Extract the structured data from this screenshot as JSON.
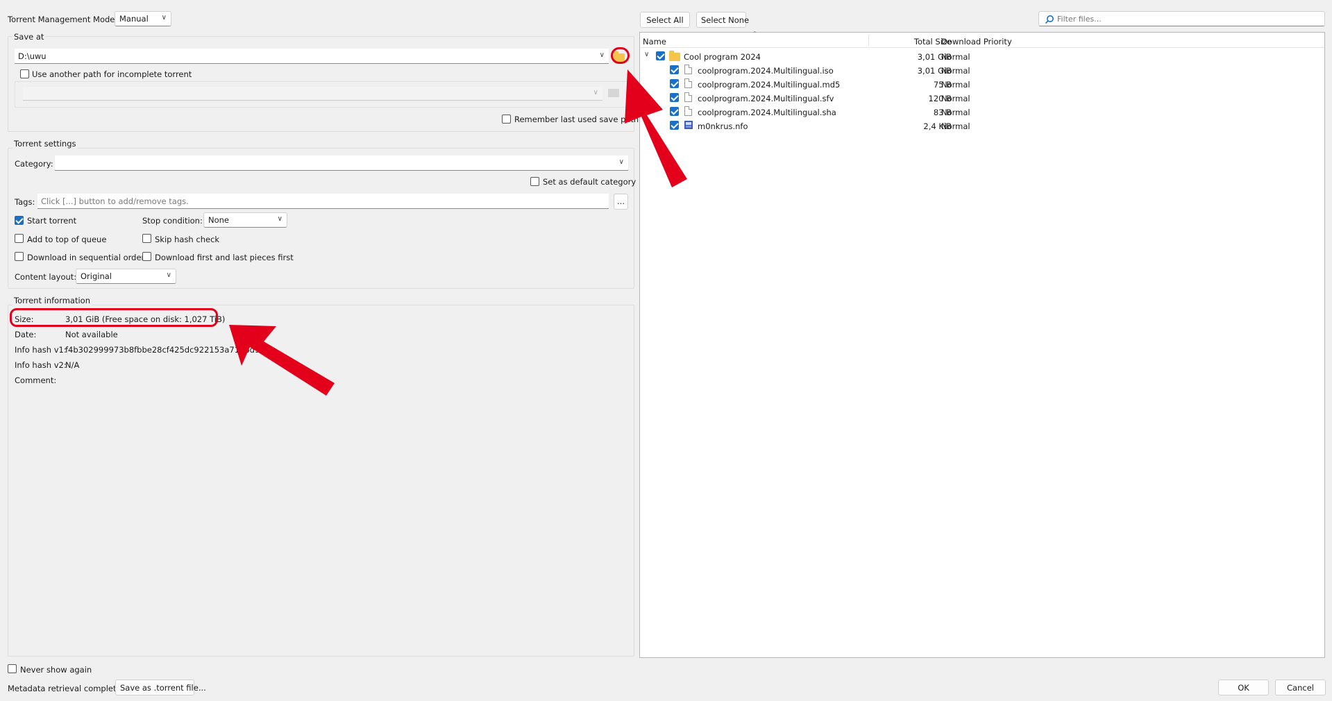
{
  "top": {
    "mode_label": "Torrent Management Mode:",
    "mode_value": "Manual",
    "select_all": "Select All",
    "select_none": "Select None",
    "filter_placeholder": "Filter files..."
  },
  "save_at": {
    "group_label": "Save at",
    "path": "D:\\uwu",
    "use_another_path": "Use another path for incomplete torrent",
    "remember": "Remember last used save path"
  },
  "settings": {
    "group_label": "Torrent settings",
    "category_label": "Category:",
    "default_category": "Set as default category",
    "tags_label": "Tags:",
    "tags_placeholder": "Click [...] button to add/remove tags.",
    "tags_button": "...",
    "start_torrent": "Start torrent",
    "stop_condition_label": "Stop condition:",
    "stop_condition_value": "None",
    "add_top": "Add to top of queue",
    "skip_hash": "Skip hash check",
    "sequential": "Download in sequential order",
    "first_last": "Download first and last pieces first",
    "layout_label": "Content layout:",
    "layout_value": "Original"
  },
  "info": {
    "group_label": "Torrent information",
    "size_label": "Size:",
    "size_value": "3,01 GiB (Free space on disk: 1,027 TiB)",
    "date_label": "Date:",
    "date_value": "Not available",
    "hash1_label": "Info hash v1:",
    "hash1_value": "f4b302999973b8fbbe28cf425dc922153a7196d9",
    "hash2_label": "Info hash v2:",
    "hash2_value": "N/A",
    "comment_label": "Comment:"
  },
  "tree": {
    "headers": [
      "Name",
      "Total Size",
      "Download Priority"
    ],
    "folder": {
      "name": "Cool program 2024",
      "size": "3,01 GiB",
      "priority": "Normal"
    },
    "files": [
      {
        "name": "coolprogram.2024.Multilingual.iso",
        "size": "3,01 GiB",
        "priority": "Normal",
        "icon": "file-icon"
      },
      {
        "name": "coolprogram.2024.Multilingual.md5",
        "size": "75 B",
        "priority": "Normal",
        "icon": "file-icon"
      },
      {
        "name": "coolprogram.2024.Multilingual.sfv",
        "size": "120 B",
        "priority": "Normal",
        "icon": "file-icon"
      },
      {
        "name": "coolprogram.2024.Multilingual.sha",
        "size": "83 B",
        "priority": "Normal",
        "icon": "file-icon"
      },
      {
        "name": "m0nkrus.nfo",
        "size": "2,4 KiB",
        "priority": "Normal",
        "icon": "nfo-icon"
      }
    ]
  },
  "bottom": {
    "never_show": "Never show again",
    "status": "Metadata retrieval complete",
    "save_torrent": "Save as .torrent file...",
    "ok": "OK",
    "cancel": "Cancel"
  },
  "colors": {
    "accent": "#1a6fc6",
    "annotation": "#e3001b"
  }
}
